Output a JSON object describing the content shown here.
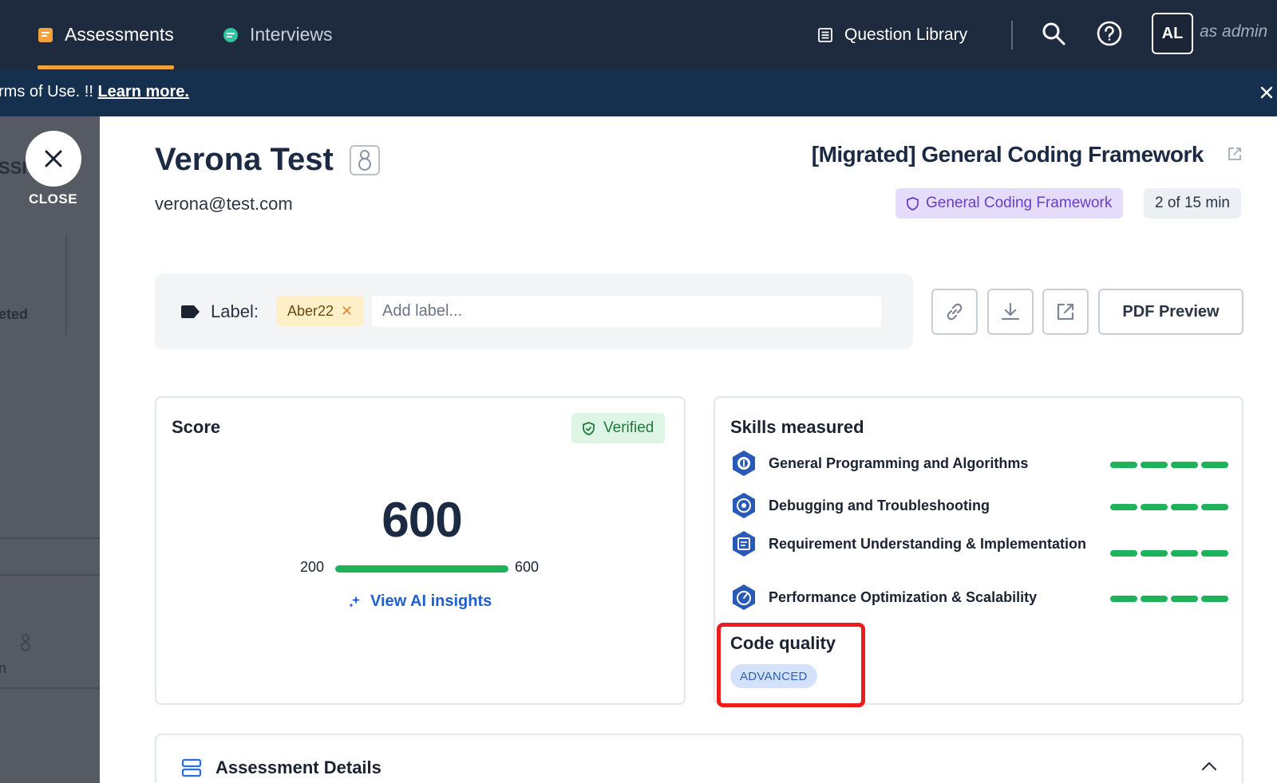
{
  "nav": {
    "tabs": [
      {
        "label": "Assessments",
        "active": true
      },
      {
        "label": "Interviews",
        "active": false
      }
    ],
    "question_library": "Question Library",
    "avatar_initials": "AL",
    "as_admin": "as admin"
  },
  "banner": {
    "text": "rms of Use. !! ",
    "link": "Learn more."
  },
  "background_panel": {
    "fragment_top": "SSI",
    "fragment_mid": "eted",
    "fragment_bottom": "n"
  },
  "close": {
    "label": "CLOSE"
  },
  "candidate": {
    "name": "Verona Test",
    "email": "verona@test.com"
  },
  "test": {
    "title": "[Migrated] General Coding Framework",
    "framework_chip": "General Coding Framework",
    "time_chip": "2 of 15 min"
  },
  "labels": {
    "label_text": "Label:",
    "chips": [
      "Aber22"
    ],
    "placeholder": "Add label..."
  },
  "actions": {
    "pdf_preview": "PDF Preview"
  },
  "score": {
    "title": "Score",
    "verified": "Verified",
    "value": "600",
    "range_min": "200",
    "range_max": "600",
    "fill_fraction": 1.0,
    "ai_link": "View AI insights"
  },
  "skills": {
    "title": "Skills measured",
    "items": [
      {
        "name": "General Programming and Algorithms",
        "level": 4,
        "max": 4
      },
      {
        "name": "Debugging and Troubleshooting",
        "level": 4,
        "max": 4
      },
      {
        "name": "Requirement Understanding & Implementation",
        "level": 4,
        "max": 4
      },
      {
        "name": "Performance Optimization & Scalability",
        "level": 4,
        "max": 4
      }
    ],
    "code_quality_title": "Code quality",
    "code_quality_level": "ADVANCED"
  },
  "details": {
    "title": "Assessment Details"
  },
  "colors": {
    "nav_bg": "#1e2a3e",
    "banner_bg": "#15304f",
    "accent_orange": "#f6a03b",
    "success_green": "#1eb25a",
    "link_blue": "#1e5fd1",
    "highlight_red": "#ee1d1d"
  }
}
